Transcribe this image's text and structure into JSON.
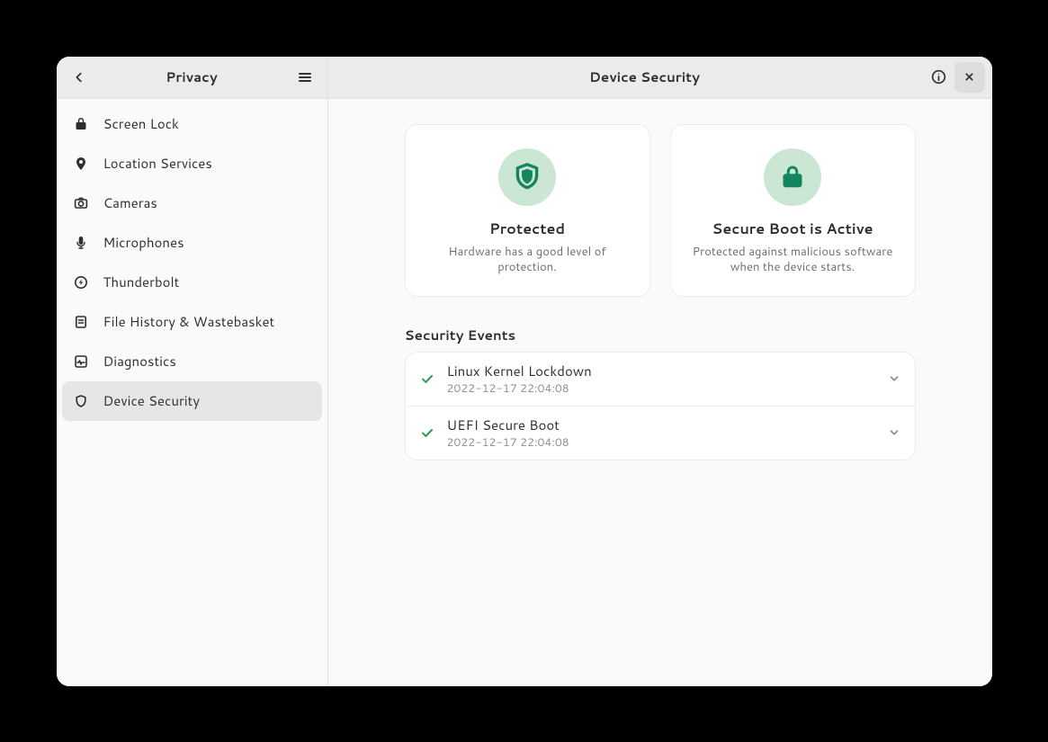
{
  "sidebar": {
    "title": "Privacy",
    "items": [
      {
        "icon": "lock",
        "label": "Screen Lock",
        "active": false
      },
      {
        "icon": "location",
        "label": "Location Services",
        "active": false
      },
      {
        "icon": "camera",
        "label": "Cameras",
        "active": false
      },
      {
        "icon": "mic",
        "label": "Microphones",
        "active": false
      },
      {
        "icon": "thunderbolt",
        "label": "Thunderbolt",
        "active": false
      },
      {
        "icon": "file",
        "label": "File History & Wastebasket",
        "active": false
      },
      {
        "icon": "diagnostics",
        "label": "Diagnostics",
        "active": false
      },
      {
        "icon": "shield",
        "label": "Device Security",
        "active": true
      }
    ]
  },
  "main": {
    "title": "Device Security",
    "cards": [
      {
        "icon": "shield",
        "title": "Protected",
        "desc": "Hardware has a good level of protection."
      },
      {
        "icon": "lock",
        "title": "Secure Boot is Active",
        "desc": "Protected against malicious software when the device starts."
      }
    ],
    "events_heading": "Security Events",
    "events": [
      {
        "status": "ok",
        "title": "Linux Kernel Lockdown",
        "time": "2022-12-17 22:04:08"
      },
      {
        "status": "ok",
        "title": "UEFI Secure Boot",
        "time": "2022-12-17 22:04:08"
      }
    ]
  }
}
